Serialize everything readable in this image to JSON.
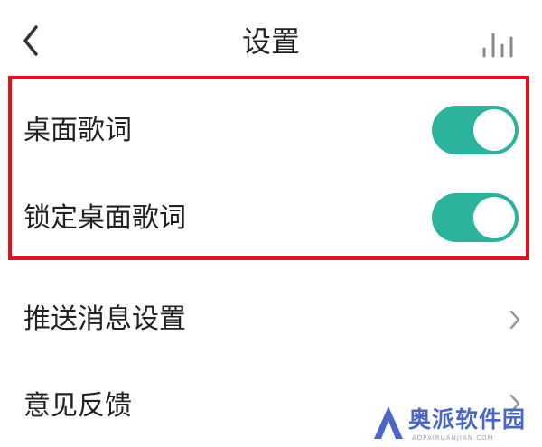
{
  "header": {
    "title": "设置",
    "back_icon": "chevron-left-icon",
    "stats_icon": "bar-chart-icon"
  },
  "highlight": {
    "color": "#e4101d"
  },
  "settings": {
    "items": [
      {
        "label": "桌面歌词",
        "type": "toggle",
        "enabled": true
      },
      {
        "label": "锁定桌面歌词",
        "type": "toggle",
        "enabled": true
      },
      {
        "label": "推送消息设置",
        "type": "link",
        "icon": "chevron-right-icon"
      },
      {
        "label": "意见反馈",
        "type": "link",
        "icon": "chevron-right-icon"
      }
    ]
  },
  "colors": {
    "toggle_on": "#2bb39c",
    "text": "#222222",
    "chevron": "#9a9a9a"
  },
  "watermark": {
    "text": "奥派软件园",
    "subtext": "AOPAIRUANJIAN.COM"
  }
}
